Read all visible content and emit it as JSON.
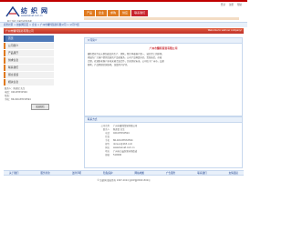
{
  "logo": {
    "name": "纺织网",
    "url": "www.texnet.com.cn",
    "slogan": "网上纺织 开拓纺织新商机"
  },
  "top_links": [
    "登录",
    "注册",
    "帮助"
  ],
  "nav": {
    "items": [
      "产品",
      "企业",
      "求购",
      "供应",
      "联系我们"
    ]
  },
  "breadcrumb": "商务社区 > 纺织网首页 > 企业 > 广州市耀纬贸易有限公司 > 公司介绍",
  "banner": {
    "title": "广州市耀纬贸易有限公司",
    "note": "Welcome to visit our company!"
  },
  "sidebar": {
    "items": [
      {
        "label": "首页"
      },
      {
        "label": "公司简介"
      },
      {
        "label": "产品展厅"
      },
      {
        "label": "供求信息"
      },
      {
        "label": "联系我们"
      },
      {
        "label": "留言反馈"
      },
      {
        "label": "相关信息"
      },
      {
        "label": "联系方式"
      }
    ]
  },
  "contact": {
    "lines": [
      "联系人：陈彦民 先生",
      "电话：020-83532594",
      "传真：",
      "手机：86-020-83532594"
    ],
    "send_button": "发送短信"
  },
  "intro_panel": {
    "header": "公司简介",
    "company_name": "广州市耀纬贸易有限公司",
    "paragraphs": [
      "耀纬贸易专业从事纺织品的生产、销售，我们本着客户第一、诚信至上的原则，",
      "竭诚为广大客户提供优质的产品和服务。公司产品种类齐全，货源充足，价格",
      "合理，欢迎新老客户来电来函洽谈合作，共创美好未来。公司位于广州市，交通",
      "便利，产品畅销全国各地，深受用户好评。"
    ]
  },
  "contact_panel": {
    "header": "联系方式",
    "rows": [
      {
        "key": "公司名称",
        "value": "广州市耀纬贸易有限公司"
      },
      {
        "key": "联系人",
        "value": "陈彦民 先生"
      },
      {
        "key": "电话",
        "value": "020-83532594"
      },
      {
        "key": "传真",
        "value": ""
      },
      {
        "key": "手机",
        "value": "86-020-83532594"
      },
      {
        "key": "邮件",
        "value": "dorsun@163.com"
      },
      {
        "key": "网址",
        "value": "www.texnet.com.cn"
      },
      {
        "key": "地址",
        "value": "广州市白云区新市新街道"
      },
      {
        "key": "邮编",
        "value": "510000"
      }
    ]
  },
  "footer": {
    "links": [
      "关于我们",
      "服务条款",
      "法律声明",
      "隐私保护",
      "网站地图",
      "广告服务",
      "联系我们",
      "友情链接"
    ],
    "copyright": "© 纺织网 版权所有 1997-2024 浙ICP备05001500号"
  },
  "colors": {
    "brand_red": "#c8232c",
    "nav_orange": "#e07a1f",
    "link_blue": "#1c3f8c"
  }
}
